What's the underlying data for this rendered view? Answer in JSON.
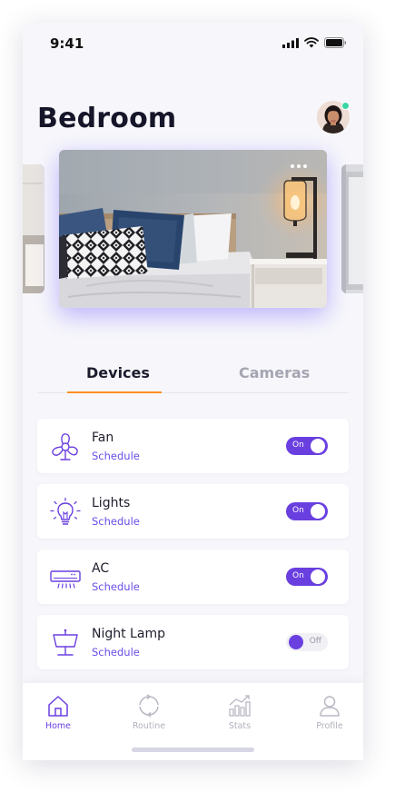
{
  "status_bar": {
    "time": "9:41"
  },
  "page": {
    "title": "Bedroom"
  },
  "tabs": [
    {
      "label": "Devices",
      "active": true
    },
    {
      "label": "Cameras",
      "active": false
    }
  ],
  "devices": [
    {
      "name": "Fan",
      "link": "Schedule",
      "icon": "fan-icon",
      "state": "On"
    },
    {
      "name": "Lights",
      "link": "Schedule",
      "icon": "lightbulb-icon",
      "state": "On"
    },
    {
      "name": "AC",
      "link": "Schedule",
      "icon": "air-conditioner-icon",
      "state": "On"
    },
    {
      "name": "Night Lamp",
      "link": "Schedule",
      "icon": "lamp-icon",
      "state": "Off"
    }
  ],
  "bottom_nav": [
    {
      "label": "Home",
      "icon": "home-icon",
      "active": true
    },
    {
      "label": "Routine",
      "icon": "routine-icon",
      "active": false
    },
    {
      "label": "Stats",
      "icon": "stats-icon",
      "active": false
    },
    {
      "label": "Profile",
      "icon": "profile-icon",
      "active": false
    }
  ],
  "colors": {
    "accent": "#6a3fe0",
    "tab_indicator": "#ff8f1f",
    "online_status": "#3ad6a2",
    "background": "#f7f7fb"
  }
}
